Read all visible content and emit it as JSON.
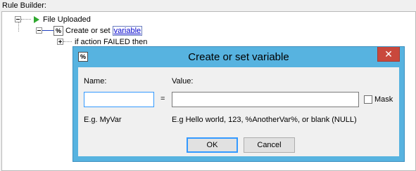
{
  "rule_builder": {
    "label": "Rule Builder:",
    "tree": {
      "root_label": "File Uploaded",
      "action_prefix": "Create or set",
      "action_link": "variable",
      "failed_label": "if action FAILED then"
    }
  },
  "dialog": {
    "title": "Create or set variable",
    "icon_glyph": "%",
    "close_glyph": "✕",
    "name_label": "Name:",
    "value_label": "Value:",
    "name_value": "",
    "value_value": "",
    "equals": "=",
    "mask_label": "Mask",
    "mask_checked": false,
    "name_hint": "E.g. MyVar",
    "value_hint": "E.g Hello world, 123, %AnotherVar%, or blank (NULL)",
    "ok_label": "OK",
    "cancel_label": "Cancel"
  },
  "colors": {
    "dialog_frame": "#57b3e0",
    "close_button": "#c9483c",
    "start_icon": "#2fa82f",
    "focus_border": "#3399ff"
  }
}
